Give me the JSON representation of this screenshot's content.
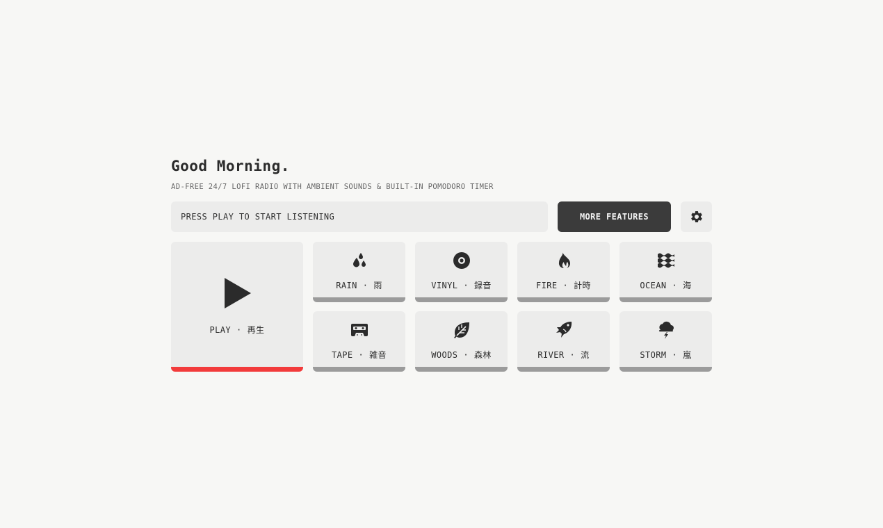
{
  "header": {
    "greeting": "Good Morning.",
    "subtitle": "AD-FREE 24/7 LOFI RADIO WITH AMBIENT SOUNDS & BUILT-IN POMODORO TIMER"
  },
  "status_bar": {
    "text": "PRESS PLAY TO START LISTENING"
  },
  "toolbar": {
    "more_features_label": "MORE FEATURES",
    "settings_icon": "gear-icon"
  },
  "play": {
    "label": "PLAY",
    "label_jp": "再生",
    "accent_color": "#f23b3b"
  },
  "separator": "·",
  "sounds": [
    {
      "name": "RAIN",
      "jp": "雨",
      "icon": "raindrops-icon"
    },
    {
      "name": "VINYL",
      "jp": "録音",
      "icon": "vinyl-record-icon"
    },
    {
      "name": "FIRE",
      "jp": "計時",
      "icon": "fire-icon"
    },
    {
      "name": "OCEAN",
      "jp": "海",
      "icon": "water-waves-icon"
    },
    {
      "name": "TAPE",
      "jp": "雑音",
      "icon": "cassette-tape-icon"
    },
    {
      "name": "WOODS",
      "jp": "森林",
      "icon": "leaf-icon"
    },
    {
      "name": "RIVER",
      "jp": "流",
      "icon": "fish-icon"
    },
    {
      "name": "STORM",
      "jp": "嵐",
      "icon": "storm-cloud-icon"
    }
  ]
}
